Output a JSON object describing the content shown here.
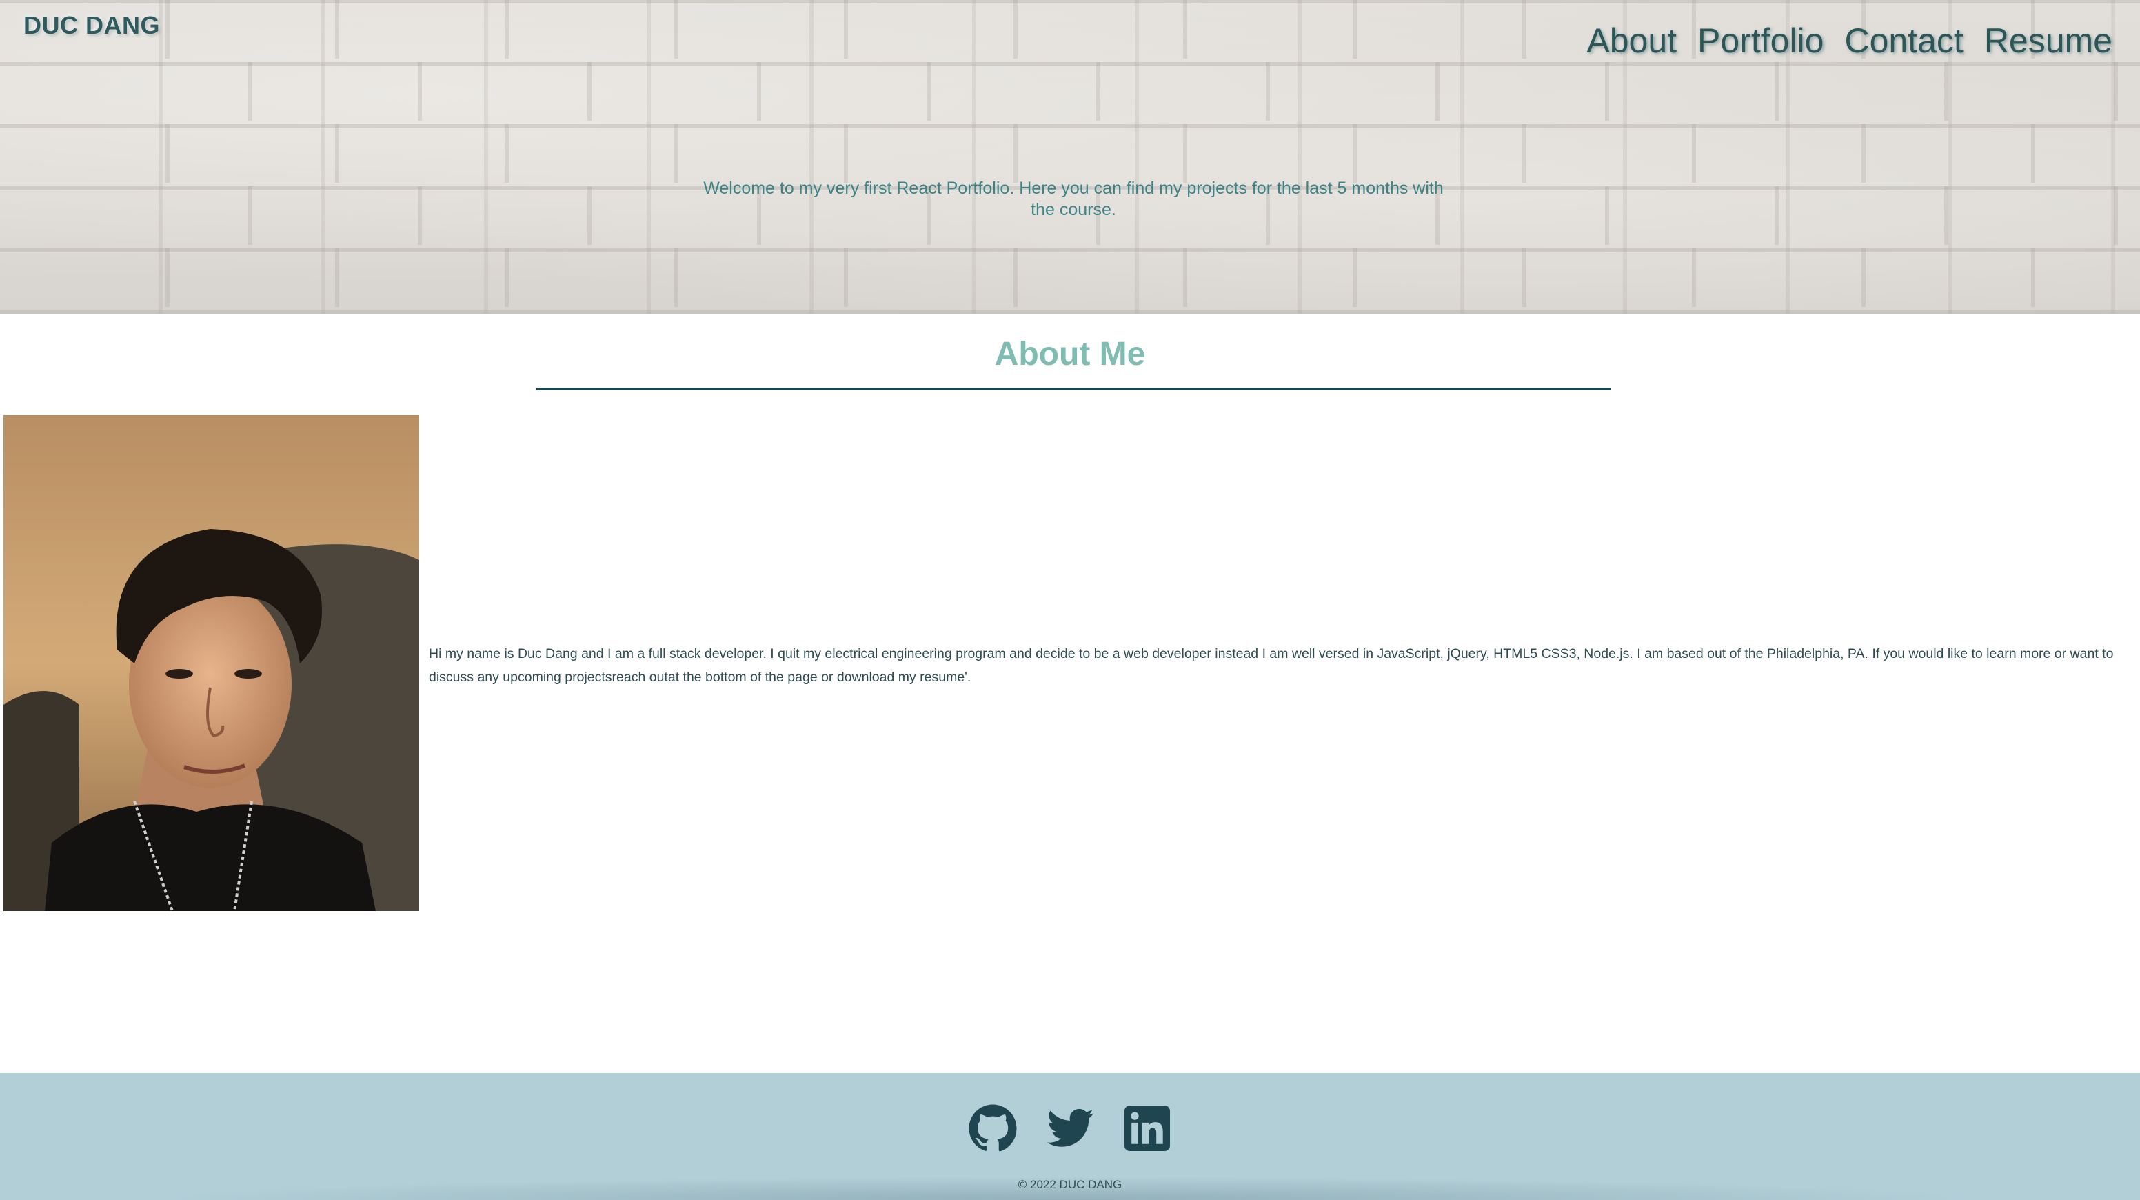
{
  "header": {
    "brand": "DUC DANG",
    "nav": [
      "About",
      "Portfolio",
      "Contact",
      "Resume"
    ],
    "welcome": "Welcome to my very first React Portfolio. Here you can find my projects for the last 5 months with the course."
  },
  "about": {
    "title": "About Me",
    "photo_alt": "Portrait of Duc Dang",
    "bio": "Hi my name is Duc Dang and I am a full stack developer. I quit my electrical engineering program and decide to be a web developer instead I am well versed in JavaScript, jQuery, HTML5 CSS3, Node.js. I am based out of the Philadelphia, PA. If you would like to learn more or want to discuss any upcoming projectsreach outat the bottom of the page or download my resume'."
  },
  "footer": {
    "socials": [
      "github-icon",
      "twitter-icon",
      "linkedin-icon"
    ],
    "copyright": "© 2022 DUC DANG"
  },
  "colors": {
    "accent": "#7fbdb2",
    "text_dark": "#2f4d52",
    "footer_bg": "#b2cfd8"
  }
}
